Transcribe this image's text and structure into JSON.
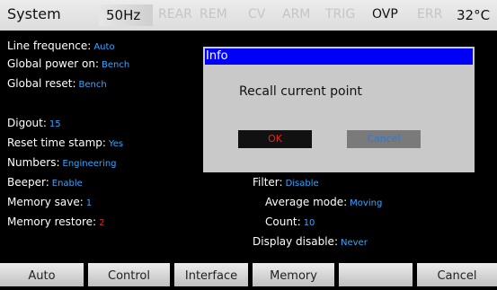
{
  "status_bar": {
    "title": "System",
    "frequency": "50Hz",
    "annunciators": [
      {
        "label": "REAR",
        "active": false
      },
      {
        "label": "REM",
        "active": false
      },
      {
        "label": "CV",
        "active": false
      },
      {
        "label": "ARM",
        "active": false
      },
      {
        "label": "TRIG",
        "active": false
      },
      {
        "label": "OVP",
        "active": true
      },
      {
        "label": "ERR",
        "active": false
      }
    ],
    "temperature": "32°C"
  },
  "settings": {
    "line_frequence": {
      "label": "Line frequence:",
      "value": "Auto"
    },
    "global_power_on": {
      "label": "Global power on:",
      "value": "Bench"
    },
    "global_reset": {
      "label": "Global reset:",
      "value": "Bench"
    },
    "digout": {
      "label": "Digout:",
      "value": "15"
    },
    "reset_time_stamp": {
      "label": "Reset time stamp:",
      "value": "Yes"
    },
    "numbers": {
      "label": "Numbers:",
      "value": "Engineering"
    },
    "beeper": {
      "label": "Beeper:",
      "value": "Enable"
    },
    "memory_save": {
      "label": "Memory save:",
      "value": "1"
    },
    "memory_restore": {
      "label": "Memory restore:",
      "value": "2"
    },
    "filter": {
      "label": "Filter:",
      "value": "Disable"
    },
    "average_mode": {
      "label": "Average mode:",
      "value": "Moving"
    },
    "count": {
      "label": "Count:",
      "value": "10"
    },
    "display_disable": {
      "label": "Display disable:",
      "value": "Never"
    }
  },
  "dialog": {
    "title": "Info",
    "message": "Recall current point",
    "ok_label": "OK",
    "cancel_label": "Cancel"
  },
  "softkeys": [
    "Auto",
    "Control",
    "Interface",
    "Memory",
    "",
    "Cancel"
  ],
  "colors": {
    "value_blue": "#36a6ff",
    "value_red": "#e5241c",
    "dialog_title_bar": "#0000f8",
    "dialog_body": "#c9c9c9",
    "cancel_text": "#2a7bd8"
  }
}
